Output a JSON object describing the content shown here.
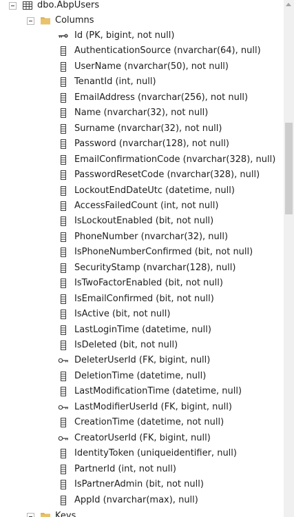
{
  "tree": {
    "table": {
      "name": "dbo.AbpUsers",
      "icon": "table-icon"
    },
    "columns_folder": {
      "name": "Columns",
      "icon": "folder-icon"
    },
    "columns": [
      {
        "label": "Id (PK, bigint, not null)",
        "icon": "primary-key-icon"
      },
      {
        "label": "AuthenticationSource (nvarchar(64), null)",
        "icon": "column-icon"
      },
      {
        "label": "UserName (nvarchar(50), not null)",
        "icon": "column-icon"
      },
      {
        "label": "TenantId (int, null)",
        "icon": "column-icon"
      },
      {
        "label": "EmailAddress (nvarchar(256), not null)",
        "icon": "column-icon"
      },
      {
        "label": "Name (nvarchar(32), not null)",
        "icon": "column-icon"
      },
      {
        "label": "Surname (nvarchar(32), not null)",
        "icon": "column-icon"
      },
      {
        "label": "Password (nvarchar(128), not null)",
        "icon": "column-icon"
      },
      {
        "label": "EmailConfirmationCode (nvarchar(328), null)",
        "icon": "column-icon"
      },
      {
        "label": "PasswordResetCode (nvarchar(328), null)",
        "icon": "column-icon"
      },
      {
        "label": "LockoutEndDateUtc (datetime, null)",
        "icon": "column-icon"
      },
      {
        "label": "AccessFailedCount (int, not null)",
        "icon": "column-icon"
      },
      {
        "label": "IsLockoutEnabled (bit, not null)",
        "icon": "column-icon"
      },
      {
        "label": "PhoneNumber (nvarchar(32), null)",
        "icon": "column-icon"
      },
      {
        "label": "IsPhoneNumberConfirmed (bit, not null)",
        "icon": "column-icon"
      },
      {
        "label": "SecurityStamp (nvarchar(128), null)",
        "icon": "column-icon"
      },
      {
        "label": "IsTwoFactorEnabled (bit, not null)",
        "icon": "column-icon"
      },
      {
        "label": "IsEmailConfirmed (bit, not null)",
        "icon": "column-icon"
      },
      {
        "label": "IsActive (bit, not null)",
        "icon": "column-icon"
      },
      {
        "label": "LastLoginTime (datetime, null)",
        "icon": "column-icon"
      },
      {
        "label": "IsDeleted (bit, not null)",
        "icon": "column-icon"
      },
      {
        "label": "DeleterUserId (FK, bigint, null)",
        "icon": "foreign-key-icon"
      },
      {
        "label": "DeletionTime (datetime, null)",
        "icon": "column-icon"
      },
      {
        "label": "LastModificationTime (datetime, null)",
        "icon": "column-icon"
      },
      {
        "label": "LastModifierUserId (FK, bigint, null)",
        "icon": "foreign-key-icon"
      },
      {
        "label": "CreationTime (datetime, not null)",
        "icon": "column-icon"
      },
      {
        "label": "CreatorUserId (FK, bigint, null)",
        "icon": "foreign-key-icon"
      },
      {
        "label": "IdentityToken (uniqueidentifier, null)",
        "icon": "column-icon"
      },
      {
        "label": "PartnerId (int, not null)",
        "icon": "column-icon"
      },
      {
        "label": "IsPartnerAdmin (bit, not null)",
        "icon": "column-icon"
      },
      {
        "label": "AppId (nvarchar(max), null)",
        "icon": "column-icon"
      }
    ],
    "keys_folder": {
      "name": "Keys",
      "icon": "folder-icon"
    }
  },
  "colors": {
    "folder": "#dcb35c",
    "icon_stroke": "#3c3c3c",
    "key": "#424242",
    "scroll_thumb": "#cdcdcd",
    "scroll_track": "#f0f0f0"
  }
}
